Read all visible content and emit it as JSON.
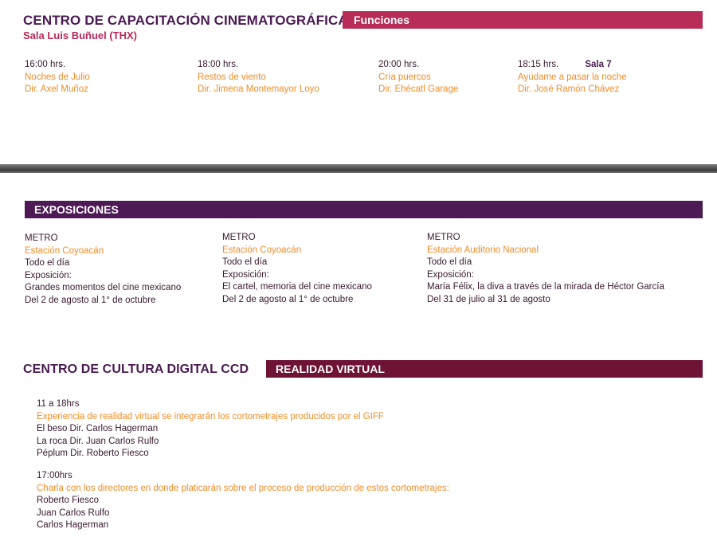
{
  "ccc": {
    "title": "CENTRO DE CAPACITACIÓN CINEMATOGRÁFICA",
    "subtitle": "Sala Luis Buñuel (THX)",
    "bar_label": "Funciones",
    "bar_color": "#b82d58",
    "functions": [
      {
        "time": "16:00 hrs.",
        "film": "Noches de Julio",
        "director": "Dir. Axel Muñoz"
      },
      {
        "time": "18:00 hrs.",
        "film": "Restos de viento",
        "director": "Dir. Jimena Montemayor Loyo"
      },
      {
        "time": "20:00 hrs.",
        "film": "Cría puercos",
        "director": "Dir. Ehécatl Garage"
      },
      {
        "time": "18:15 hrs.",
        "sala": "Sala 7",
        "film": "Ayúdame a pasar la noche",
        "director": "Dir. José Ramón Chávez"
      }
    ]
  },
  "expos": {
    "bar_label": "EXPOSICIONES",
    "bar_color": "#4e1a56",
    "items": [
      {
        "place": "METRO",
        "station": "Estación Coyoacán",
        "hours": "Todo el día",
        "type": "Exposición:",
        "name": "Grandes momentos del cine mexicano",
        "dates": "Del 2 de agosto al 1° de octubre"
      },
      {
        "place": "METRO",
        "station": "Estación Coyoacán",
        "hours": "Todo el día",
        "type": "Exposición:",
        "name": "El cartel, memoria del cine mexicano",
        "dates": "Del 2 de agosto al 1° de octubre"
      },
      {
        "place": "METRO",
        "station": "Estación Auditorio Nacional",
        "hours": "Todo el día",
        "type": "Exposición:",
        "name": "María Félix, la diva a través de la mirada de Héctor García",
        "dates": "Del 31 de julio al 31 de agosto"
      }
    ]
  },
  "ccd": {
    "title": "CENTRO DE CULTURA DIGITAL CCD",
    "bar_label": "REALIDAD VIRTUAL",
    "bar_color": "#6e1236",
    "block1": {
      "time": "11 a 18hrs",
      "desc": "Experiencia de realidad virtual se integrarán los cortometrajes producidos por el GIFF",
      "lines": [
        "El beso Dir. Carlos Hagerman",
        "La roca Dir. Juan Carlos Rulfo",
        "Péplum Dir. Roberto Fiesco"
      ]
    },
    "block2": {
      "time": "17:00hrs",
      "desc": "Charla con los directores en donde platicarán sobre el proceso de producción de estos cortometrajes:",
      "lines": [
        "Roberto Fiesco",
        "Juan Carlos Rulfo",
        "Carlos Hagerman"
      ]
    }
  }
}
